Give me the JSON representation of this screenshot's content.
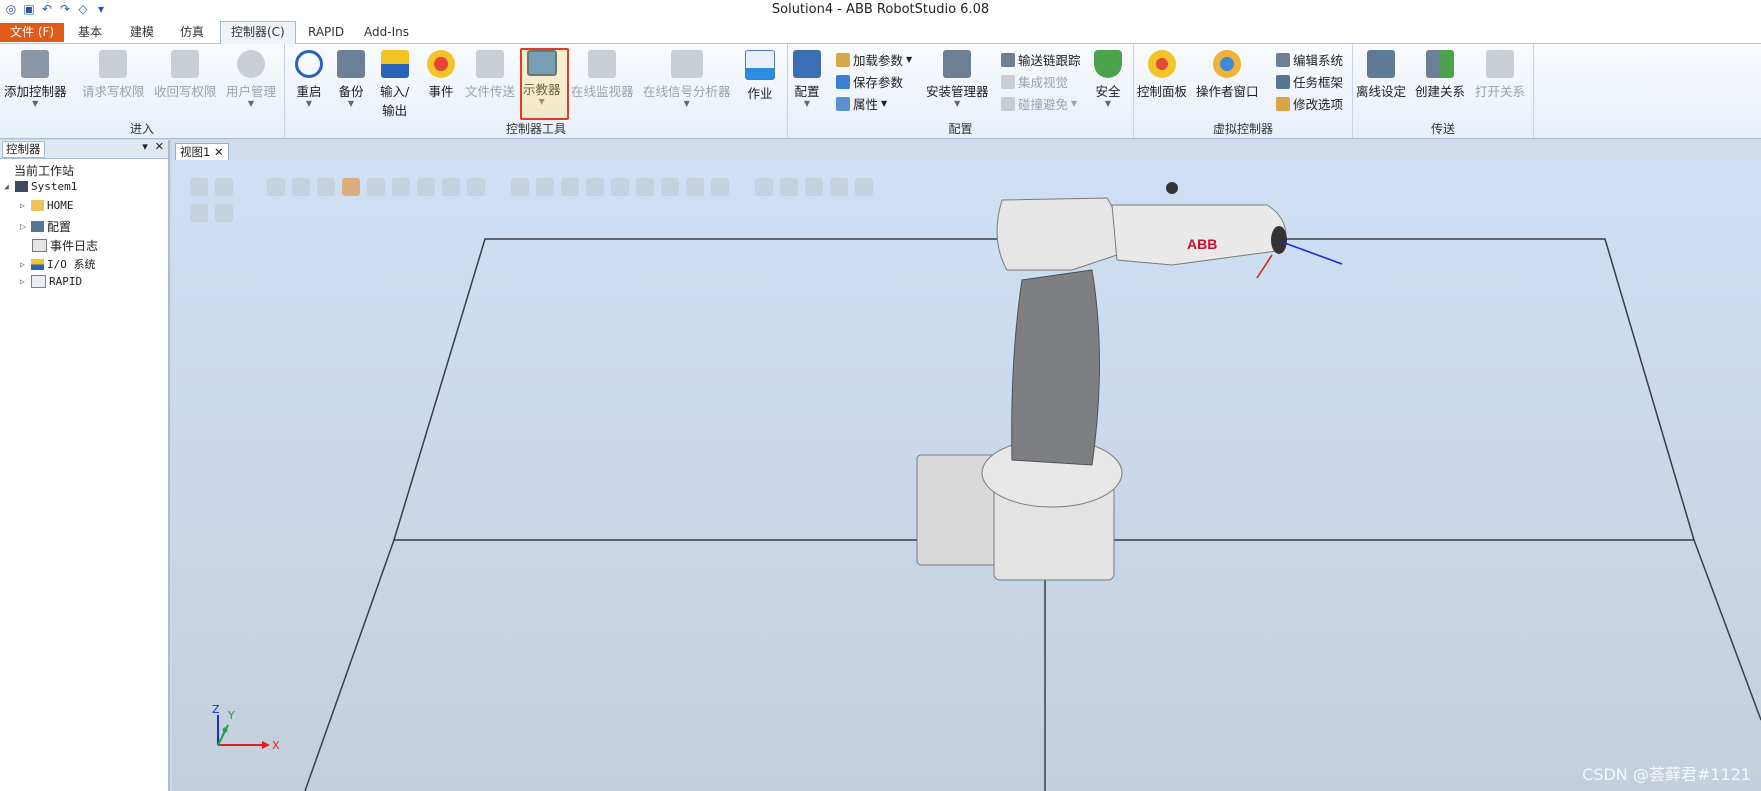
{
  "window": {
    "title": "Solution4 - ABB RobotStudio 6.08"
  },
  "tabs": [
    {
      "label": "文件 (F)"
    },
    {
      "label": "基本"
    },
    {
      "label": "建模"
    },
    {
      "label": "仿真"
    },
    {
      "label": "控制器(C)"
    },
    {
      "label": "RAPID"
    },
    {
      "label": "Add-Ins"
    }
  ],
  "ribbon": {
    "groups": {
      "enter": "进入",
      "controller_tools": "控制器工具",
      "config": "配置",
      "virtual_controller": "虚拟控制器",
      "transfer": "传送"
    },
    "buttons": {
      "add_controller": "添加控制器",
      "request_write": "请求写权限",
      "revoke_write": "收回写权限",
      "user_mgmt": "用户管理",
      "restart": "重启",
      "backup": "备份",
      "io_line1": "输入/",
      "io_line2": "输出",
      "events": "事件",
      "file_transfer": "文件传送",
      "flexpendant": "示教器",
      "online_monitor": "在线监视器",
      "signal_analyzer": "在线信号分析器",
      "jobs": "作业",
      "configure": "配置",
      "load_params": "加载参数",
      "save_params": "保存参数",
      "properties": "属性",
      "install_manager": "安装管理器",
      "conveyor_track": "输送链跟踪",
      "integrated_vision": "集成视觉",
      "collision_avoid": "碰撞避免",
      "safety": "安全",
      "control_panel": "控制面板",
      "operator_window": "操作者窗口",
      "edit_system": "编辑系统",
      "task_frames": "任务框架",
      "modify_options": "修改选项",
      "offline_setup": "离线设定",
      "create_relation": "创建关系",
      "open_relation": "打开关系"
    }
  },
  "left_panel": {
    "tab": "控制器",
    "tree": {
      "root": "当前工作站",
      "system": "System1",
      "home": "HOME",
      "config": "配置",
      "event_log": "事件日志",
      "io_system": "I/O 系统",
      "rapid": "RAPID"
    }
  },
  "viewport": {
    "tab": "视图1",
    "robot_logo": "ABB",
    "axes": {
      "x": "X",
      "y": "Y",
      "z": "Z"
    },
    "watermark": "CSDN @荟藓君#1121"
  }
}
